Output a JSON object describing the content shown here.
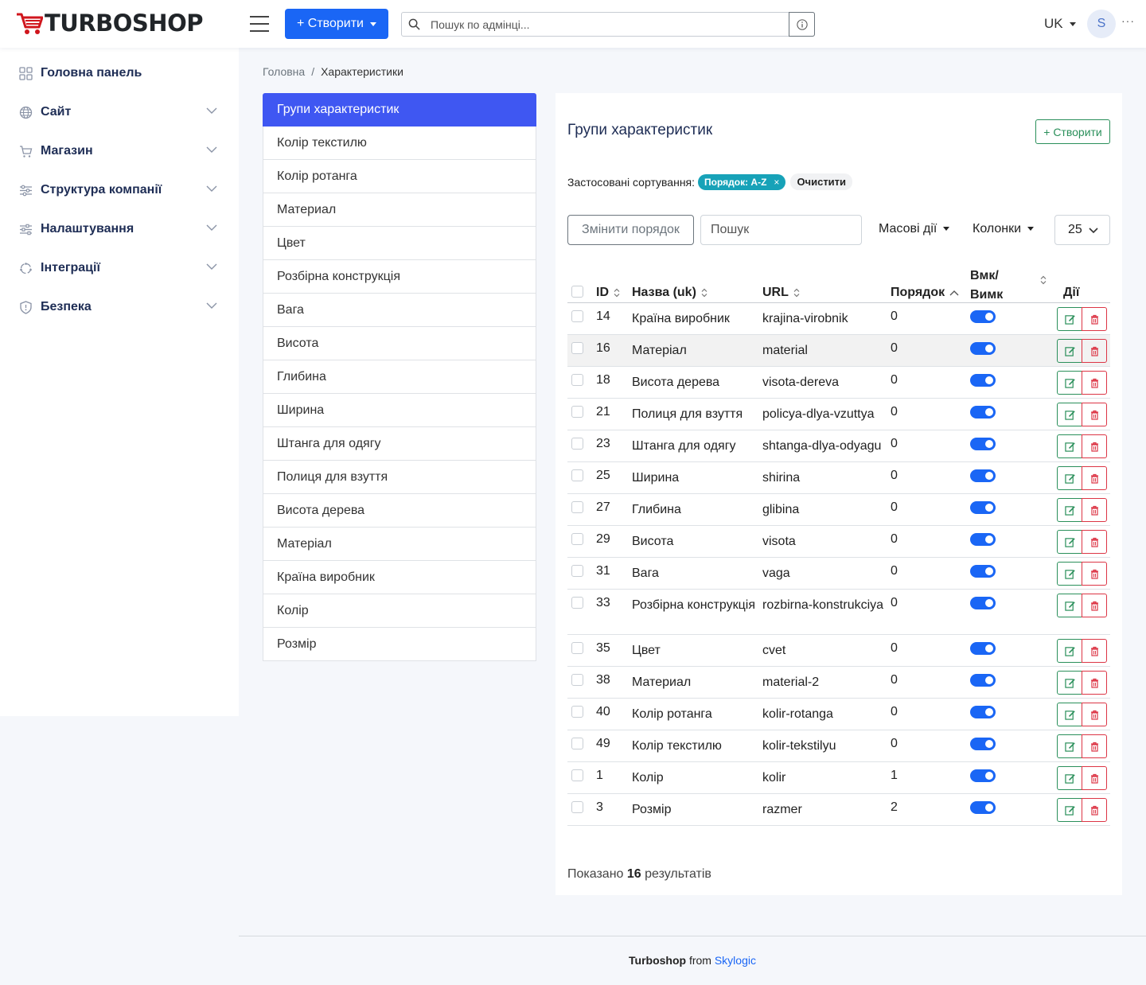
{
  "header": {
    "logo_text": "TURBOSHOP",
    "create_label": "+ Створити",
    "search_placeholder": "Пошук по адмінці...",
    "lang": "UK",
    "avatar_initial": "S"
  },
  "sidebar": {
    "items": [
      {
        "label": "Головна панель",
        "icon": "dashboard-icon"
      },
      {
        "label": "Сайт",
        "icon": "globe-icon"
      },
      {
        "label": "Магазин",
        "icon": "cart-icon"
      },
      {
        "label": "Структура компанії",
        "icon": "structure-icon"
      },
      {
        "label": "Налаштування",
        "icon": "sliders-icon"
      },
      {
        "label": "Інтеграції",
        "icon": "integrations-icon"
      },
      {
        "label": "Безпека",
        "icon": "shield-icon"
      }
    ]
  },
  "breadcrumb": {
    "home": "Головна",
    "current": "Характеристики"
  },
  "groups": [
    "Групи характеристик",
    "Колір текстилю",
    "Колір ротанга",
    "Материал",
    "Цвет",
    "Розбірна конструкція",
    "Вага",
    "Висота",
    "Глибина",
    "Ширина",
    "Штанга для одягу",
    "Полиця для взуття",
    "Висота дерева",
    "Матеріал",
    "Країна виробник",
    "Колір",
    "Розмір"
  ],
  "card": {
    "title": "Групи характеристик",
    "create_label": "+ Створити",
    "sort_label": "Застосовані сортування:",
    "sort_pill": "Порядок: A-Z",
    "sort_pill_close": "×",
    "sort_clear": "Очистити",
    "reorder_label": "Змінити порядок",
    "search_placeholder": "Пошук",
    "bulk_label": "Масові дії",
    "columns_label": "Колонки",
    "per_page": "25",
    "results_prefix": "Показано",
    "results_count": "16",
    "results_suffix": "результатів"
  },
  "table": {
    "headers": {
      "id": "ID",
      "name": "Назва (uk)",
      "url": "URL",
      "order": "Порядок",
      "toggle_1": "Вмк/",
      "toggle_2": "Вимк",
      "actions": "Дії"
    },
    "rows": [
      {
        "id": "14",
        "name": "Країна виробник",
        "url": "krajina-virobnik",
        "order": "0",
        "enabled": true
      },
      {
        "id": "16",
        "name": "Матеріал",
        "url": "material",
        "order": "0",
        "enabled": true
      },
      {
        "id": "18",
        "name": "Висота дерева",
        "url": "visota-dereva",
        "order": "0",
        "enabled": true
      },
      {
        "id": "21",
        "name": "Полиця для взуття",
        "url": "policya-dlya-vzuttya",
        "order": "0",
        "enabled": true
      },
      {
        "id": "23",
        "name": "Штанга для одягу",
        "url": "shtanga-dlya-odyagu",
        "order": "0",
        "enabled": true
      },
      {
        "id": "25",
        "name": "Ширина",
        "url": "shirina",
        "order": "0",
        "enabled": true
      },
      {
        "id": "27",
        "name": "Глибина",
        "url": "glibina",
        "order": "0",
        "enabled": true
      },
      {
        "id": "29",
        "name": "Висота",
        "url": "visota",
        "order": "0",
        "enabled": true
      },
      {
        "id": "31",
        "name": "Вага",
        "url": "vaga",
        "order": "0",
        "enabled": true
      },
      {
        "id": "33",
        "name": "Розбірна конструкція",
        "url": "rozbirna-konstrukciya",
        "order": "0",
        "enabled": true
      },
      {
        "id": "35",
        "name": "Цвет",
        "url": "cvet",
        "order": "0",
        "enabled": true
      },
      {
        "id": "38",
        "name": "Материал",
        "url": "material-2",
        "order": "0",
        "enabled": true
      },
      {
        "id": "40",
        "name": "Колір ротанга",
        "url": "kolir-rotanga",
        "order": "0",
        "enabled": true
      },
      {
        "id": "49",
        "name": "Колір текстилю",
        "url": "kolir-tekstilyu",
        "order": "0",
        "enabled": true
      },
      {
        "id": "1",
        "name": "Колір",
        "url": "kolir",
        "order": "1",
        "enabled": true
      },
      {
        "id": "3",
        "name": "Розмір",
        "url": "razmer",
        "order": "2",
        "enabled": true
      }
    ]
  },
  "footer": {
    "brand": "Turboshop",
    "from": "from",
    "link": "Skylogic"
  },
  "colors": {
    "accent": "#1a66f5",
    "active_group": "#3f57f2",
    "edit": "#2a8f5a",
    "delete": "#dc3545",
    "pill": "#17a2b8"
  }
}
